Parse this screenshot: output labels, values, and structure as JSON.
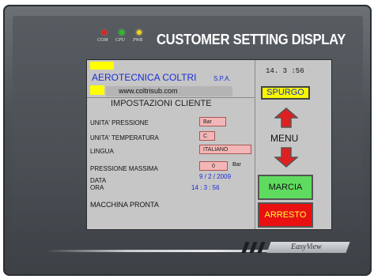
{
  "device": {
    "led_labels": [
      "COM",
      "CPU",
      "PWR"
    ],
    "led_colors": [
      "#e02020",
      "#22c022",
      "#f0d020"
    ],
    "headline": "CUSTOMER SETTING DISPLAY",
    "brand": "EasyView"
  },
  "screen": {
    "company": "AEROTECNICA COLTRI",
    "company_suffix": "S.P.A.",
    "website": "www.coltrisub.com",
    "clock": "14. 3 :56",
    "section_title": "IMPOSTAZIONI CLIENTE",
    "pressure_unit_label": "UNITA' PRESSIONE",
    "pressure_unit_value": "Bar",
    "temp_unit_label": "UNITA' TEMPERATURA",
    "temp_unit_value": "C",
    "language_label": "LINGUA",
    "language_value": "ITALIANO",
    "max_pressure_label": "PRESSIONE MASSIMA",
    "max_pressure_value": "0",
    "max_pressure_unit": "Bar",
    "date_label": "DATA",
    "date_value": "9 / 2 / 2009",
    "time_label": "ORA",
    "time_value": "14 : 3 : 56",
    "status": "MACCHINA PRONTA",
    "purge_button": "SPURGO",
    "menu_label": "MENU",
    "start_button": "MARCIA",
    "stop_button": "ARRESTO",
    "colors": {
      "screen_bg": "#c6c6c6",
      "title_blue": "#1c2fd0",
      "logo_yellow": "#ffff00",
      "field_pink": "#f3b6b6",
      "date_blue": "#1a2ad8",
      "button_yellow": "#f6f600",
      "button_green": "#5fdc5f",
      "button_red": "#e81010",
      "arrow_red": "#e02020"
    }
  }
}
